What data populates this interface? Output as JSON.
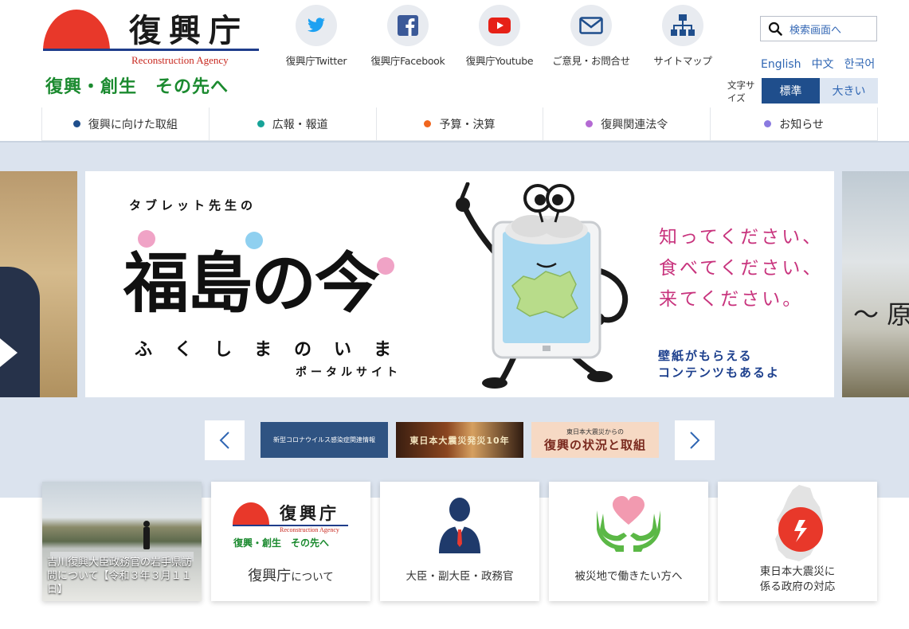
{
  "header": {
    "logo_title": "復興庁",
    "logo_subtitle": "Reconstruction Agency",
    "tagline": "復興・創生　その先へ",
    "social": [
      {
        "label": "復興庁Twitter",
        "icon": "twitter-icon",
        "color": "#1da1f2"
      },
      {
        "label": "復興庁Facebook",
        "icon": "facebook-icon",
        "color": "#3b5998"
      },
      {
        "label": "復興庁Youtube",
        "icon": "youtube-icon",
        "color": "#e62117"
      },
      {
        "label": "ご意見・お問合せ",
        "icon": "mail-icon",
        "color": "#1f4e8c"
      },
      {
        "label": "サイトマップ",
        "icon": "sitemap-icon",
        "color": "#1f4e8c"
      }
    ],
    "search_label": "検索画面へ",
    "languages": [
      "English",
      "中文",
      "한국어"
    ],
    "fontsize_label": "文字サイズ",
    "fontsize_standard": "標準",
    "fontsize_large": "大きい"
  },
  "nav": [
    {
      "label": "復興に向けた取組",
      "color": "#1f4e8c"
    },
    {
      "label": "広報・報道",
      "color": "#17a398"
    },
    {
      "label": "予算・決算",
      "color": "#f0661f"
    },
    {
      "label": "復興関連法令",
      "color": "#b46ad3"
    },
    {
      "label": "お知らせ",
      "color": "#8a7ae0"
    }
  ],
  "banner": {
    "kicker": "タブレット先生の",
    "title": "福島の今",
    "kana": "ふくしまのいま",
    "portal": "ポータルサイト",
    "message": [
      "知ってください、",
      "食べてください、",
      "来てください。"
    ],
    "note": [
      "壁紙がもらえる",
      "コンテンツもあるよ"
    ],
    "next_slide_peek": "～ 原"
  },
  "carousel": {
    "thumbs": [
      {
        "label": "新型コロナウイルス感染症関連情報"
      },
      {
        "label": "東日本大震災発災10年"
      },
      {
        "label_top": "東日本大震災からの",
        "label_main": "復興の状況と取組"
      }
    ]
  },
  "cards": [
    {
      "label": "吉川復興大臣政務官の岩手県訪問について【令和３年３月１１日】"
    },
    {
      "logo_title": "復興庁",
      "logo_subtitle": "Reconstruction Agency",
      "tagline": "復興・創生　その先へ",
      "label_main": "復興庁",
      "label_suffix": "について"
    },
    {
      "label": "大臣・副大臣・政務官"
    },
    {
      "label": "被災地で働きたい方へ"
    },
    {
      "label_line1": "東日本大震災に",
      "label_line2": "係る政府の対応"
    }
  ]
}
